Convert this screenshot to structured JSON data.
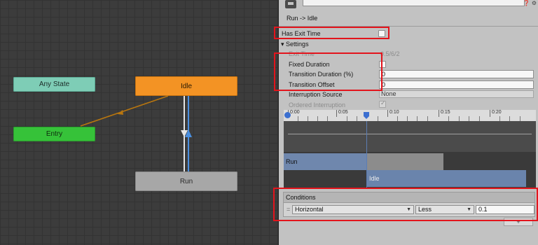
{
  "graph": {
    "nodes": {
      "any_state": "Any State",
      "entry": "Entry",
      "idle": "Idle",
      "run": "Run"
    },
    "colors": {
      "any_state": "#7ecdb6",
      "entry": "#36c239",
      "idle": "#f39324",
      "run": "#a7a7a7"
    }
  },
  "inspector": {
    "title": "Run -> Idle",
    "has_exit_time_label": "Has Exit Time",
    "has_exit_time_checked": false,
    "settings_label": "Settings",
    "exit_time_label": "Exit Time",
    "exit_time_value": "0.5/6/2",
    "fixed_duration_label": "Fixed Duration",
    "fixed_duration_checked": false,
    "transition_duration_label": "Transition Duration (%)",
    "transition_duration_value": "0",
    "transition_offset_label": "Transition Offset",
    "transition_offset_value": "0",
    "interruption_source_label": "Interruption Source",
    "interruption_source_value": "None",
    "ordered_interruption_label": "Ordered Interruption",
    "ordered_interruption_checked": true,
    "header_icons": "❓ ⚙"
  },
  "timeline": {
    "ticks": [
      "0:00",
      "0:05",
      "0:10",
      "0:15",
      "0:20"
    ],
    "tracks": {
      "from": "Run",
      "to": "Idle"
    }
  },
  "conditions": {
    "header": "Conditions",
    "rows": [
      {
        "parameter": "Horizontal",
        "operator": "Less",
        "value": "0.1"
      }
    ],
    "add_button": "+"
  }
}
